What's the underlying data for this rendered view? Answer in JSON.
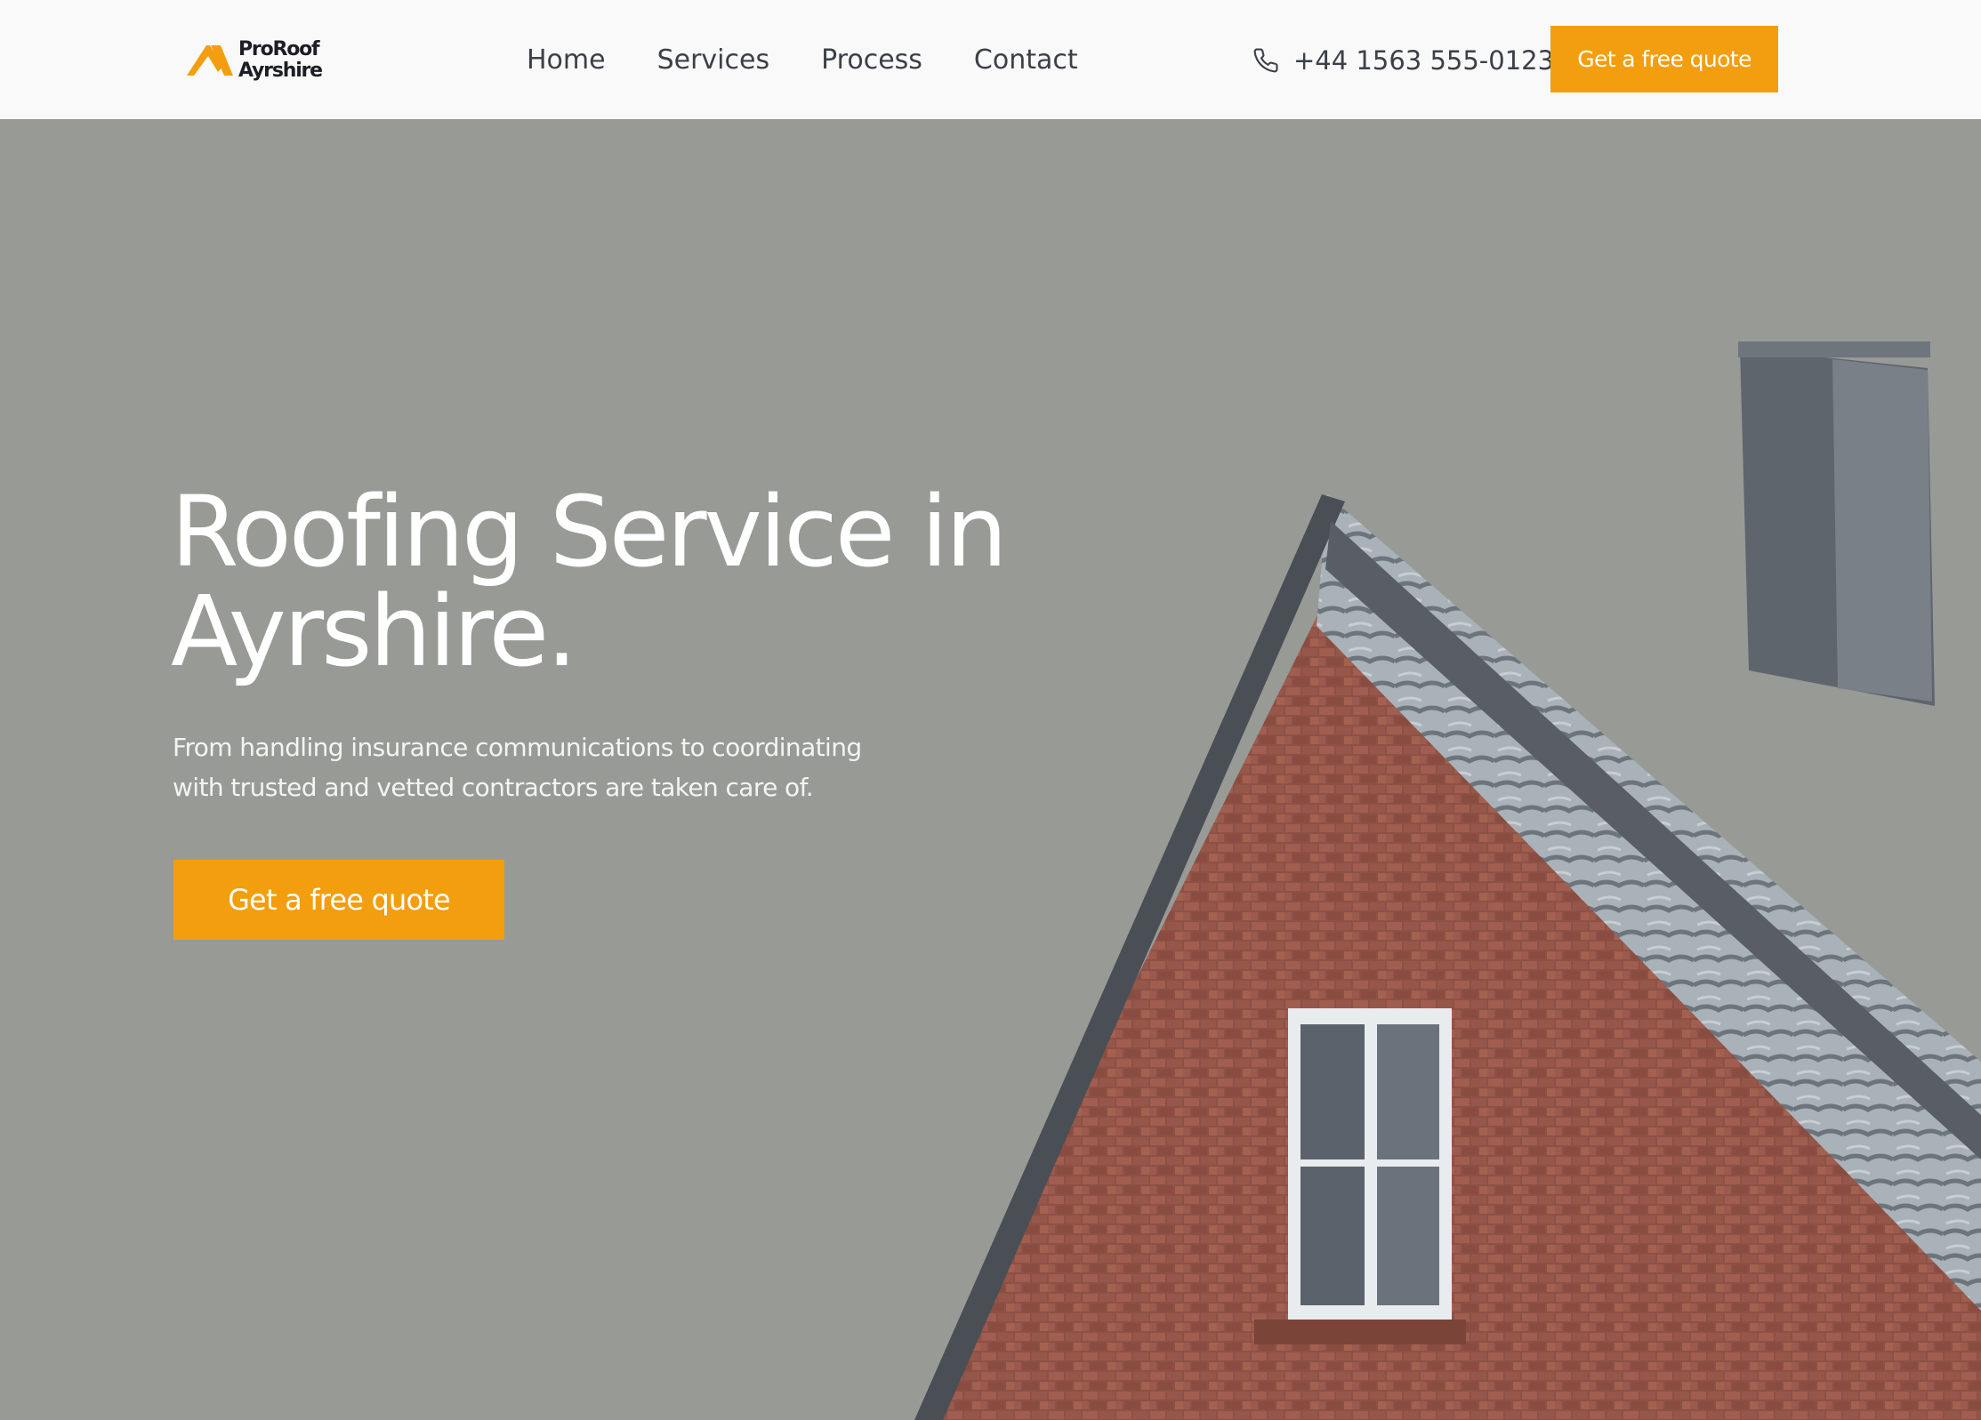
{
  "brand": {
    "line1": "ProRoof",
    "line2": "Ayrshire",
    "accent_color": "#f39e0f"
  },
  "nav": {
    "items": [
      {
        "label": "Home"
      },
      {
        "label": "Services"
      },
      {
        "label": "Process"
      },
      {
        "label": "Contact"
      }
    ]
  },
  "header": {
    "phone_icon": "phone-icon",
    "phone": "+44 1563 555-0123",
    "cta_label": "Get a free quote"
  },
  "hero": {
    "title": "Roofing Service in Ayrshire.",
    "subtitle": "From handling insurance communications to coordinating with trusted and vetted contractors are taken care of.",
    "cta_label": "Get a free quote",
    "background_color": "#989a96"
  }
}
